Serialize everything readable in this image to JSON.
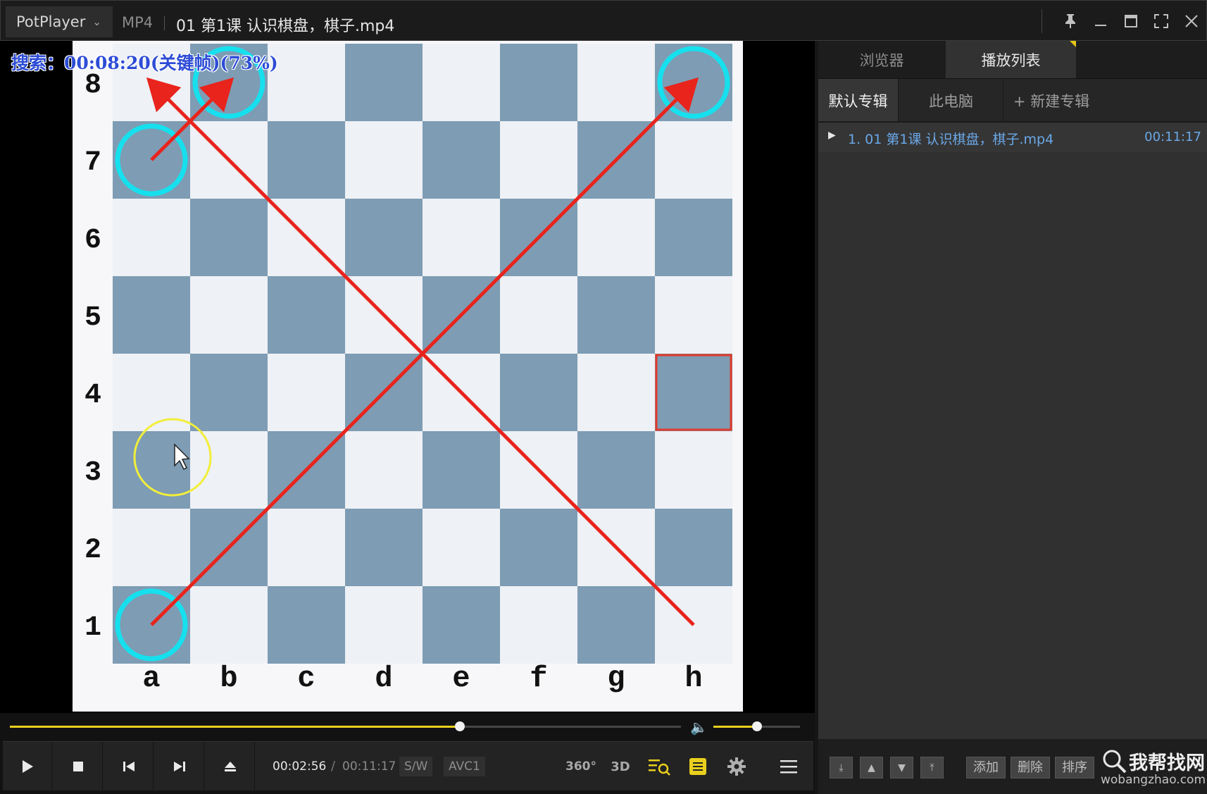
{
  "titlebar": {
    "app_name": "PotPlayer",
    "format": "MP4",
    "file_title": "01 第1课  认识棋盘，棋子.mp4",
    "buttons": [
      "pin",
      "minimize",
      "maximize",
      "fullscreen",
      "close"
    ]
  },
  "video": {
    "osd_text": "搜索：00:08:20(关键帧)(73%)",
    "board": {
      "ranks": [
        "8",
        "7",
        "6",
        "5",
        "4",
        "3",
        "2",
        "1"
      ],
      "files": [
        "a",
        "b",
        "c",
        "d",
        "e",
        "f",
        "g",
        "h"
      ],
      "light_square_color": "#eef1f5",
      "dark_square_color": "#7e9cb4",
      "highlight_circles": [
        "a1",
        "a7",
        "b8",
        "h8"
      ],
      "highlight_circle_color": "#16e0ee",
      "arrows": [
        [
          "a1",
          "h8"
        ],
        [
          "h1",
          "a8"
        ],
        [
          "a7",
          "b8"
        ]
      ],
      "arrow_color": "#e8241c",
      "square_marker": "h4",
      "square_marker_color": "#e03a2a",
      "cursor_highlight": "a3",
      "cursor_highlight_color": "#f2ee3a"
    }
  },
  "controls": {
    "seek_progress": 0.67,
    "volume_level": 0.5,
    "time_current": "00:02:56",
    "time_separator": "/",
    "time_total": "00:11:17",
    "codec_render": "S/W",
    "codec_video": "AVC1",
    "label_360": "360°",
    "label_3d": "3D",
    "accent_color": "#e9cf1d"
  },
  "panel": {
    "tab_browser": "浏览器",
    "tab_playlist": "播放列表",
    "subtab_default": "默认专辑",
    "subtab_computer": "此电脑",
    "subtab_new": "+ 新建专辑",
    "playlist": [
      {
        "title": "1. 01 第1课  认识棋盘，棋子.mp4",
        "duration": "00:11:17"
      }
    ],
    "buttons": {
      "add": "添加",
      "delete": "删除",
      "sort": "排序"
    },
    "link_color": "#6aa8e8"
  },
  "watermark": {
    "cn": "我帮找网",
    "en": "wobangzhao.com"
  }
}
